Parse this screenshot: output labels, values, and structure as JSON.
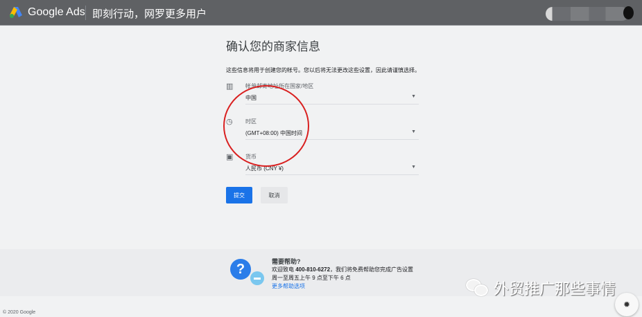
{
  "header": {
    "brand": "Google Ads",
    "slogan": "即刻行动，网罗更多用户"
  },
  "page": {
    "title": "确认您的商家信息",
    "description": "这些信息将用于创建您的帐号。您以后将无法更改这些设置，因此请谨慎选择。"
  },
  "fields": [
    {
      "icon": "map-icon",
      "label": "帐单邮寄地址所在国家/地区",
      "value": "中国"
    },
    {
      "icon": "clock-icon",
      "label": "时区",
      "value": "(GMT+08:00) 中国时间"
    },
    {
      "icon": "currency-icon",
      "label": "货币",
      "value": "人民币 (CNY ¥)"
    }
  ],
  "buttons": {
    "submit": "提交",
    "cancel": "取消"
  },
  "help": {
    "title": "需要帮助?",
    "line1_prefix": "欢迎致电 ",
    "phone": "400-810-6272",
    "line1_suffix": "，我们将免费帮助您完成广告设置",
    "line2": "周一至周五上午 9 点至下午 6 点",
    "link": "更多帮助选项"
  },
  "footer": {
    "copyright": "© 2020 Google"
  },
  "watermark": {
    "text": "外贸推广那些事情"
  },
  "colors": {
    "accent": "#1a73e8",
    "topbar": "#5f6164",
    "annotation": "#d92020"
  }
}
